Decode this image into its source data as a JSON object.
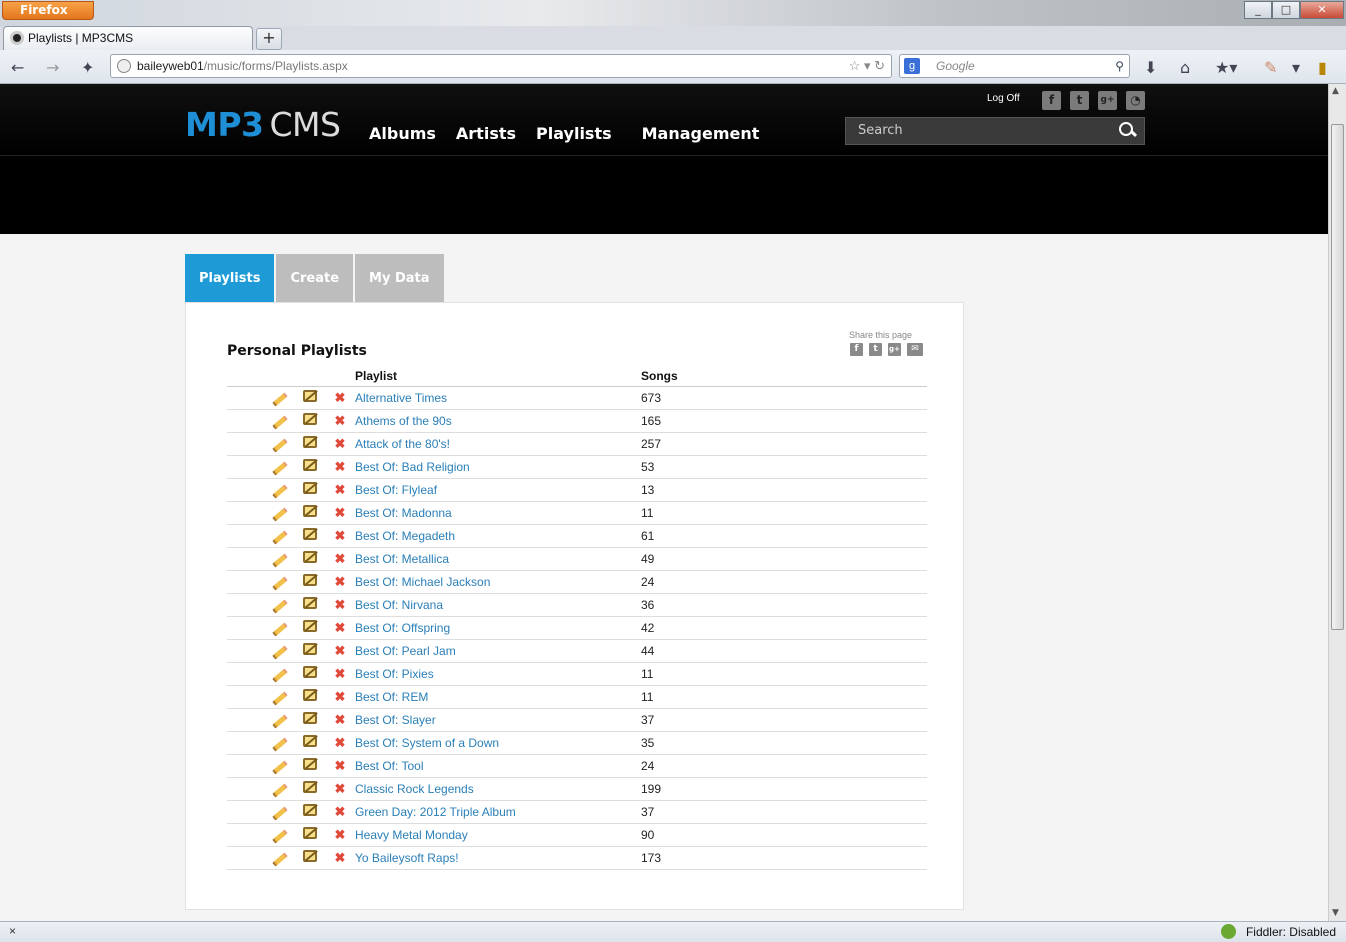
{
  "browser": {
    "app_button": "Firefox",
    "tab_title": "Playlists | MP3CMS",
    "new_tab": "+",
    "url_host": "baileyweb01",
    "url_path": "/music/forms/Playlists.aspx",
    "search_placeholder": "Google",
    "search_engine_icon": "google-g-icon",
    "status_close": "×",
    "status_fiddler": "Fiddler: Disabled"
  },
  "site": {
    "logo_mp3": "MP3",
    "logo_cms": "CMS",
    "nav": [
      "Albums",
      "Artists",
      "Playlists",
      "Management"
    ],
    "logoff": "Log Off",
    "search_placeholder": "Search",
    "social": [
      "f",
      "t",
      "g+",
      "rss"
    ],
    "accent": "#1e8fd6"
  },
  "subtabs": [
    "Playlists",
    "Create",
    "My Data"
  ],
  "panel": {
    "title": "Personal Playlists",
    "share_label": "Share this page",
    "share_icons": [
      "f",
      "t",
      "g+",
      "mail"
    ]
  },
  "table": {
    "columns": [
      "Playlist",
      "Songs"
    ],
    "rows": [
      {
        "name": "Alternative Times",
        "songs": "673"
      },
      {
        "name": "Athems of the 90s",
        "songs": "165"
      },
      {
        "name": "Attack of the 80's!",
        "songs": "257"
      },
      {
        "name": "Best Of: Bad Religion",
        "songs": "53"
      },
      {
        "name": "Best Of: Flyleaf",
        "songs": "13"
      },
      {
        "name": "Best Of: Madonna",
        "songs": "11"
      },
      {
        "name": "Best Of: Megadeth",
        "songs": "61"
      },
      {
        "name": "Best Of: Metallica",
        "songs": "49"
      },
      {
        "name": "Best Of: Michael Jackson",
        "songs": "24"
      },
      {
        "name": "Best Of: Nirvana",
        "songs": "36"
      },
      {
        "name": "Best Of: Offspring",
        "songs": "42"
      },
      {
        "name": "Best Of: Pearl Jam",
        "songs": "44"
      },
      {
        "name": "Best Of: Pixies",
        "songs": "11"
      },
      {
        "name": "Best Of: REM",
        "songs": "11"
      },
      {
        "name": "Best Of: Slayer",
        "songs": "37"
      },
      {
        "name": "Best Of: System of a Down",
        "songs": "35"
      },
      {
        "name": "Best Of: Tool",
        "songs": "24"
      },
      {
        "name": "Classic Rock Legends",
        "songs": "199"
      },
      {
        "name": "Green Day: 2012 Triple Album",
        "songs": "37"
      },
      {
        "name": "Heavy Metal Monday",
        "songs": "90"
      },
      {
        "name": "Yo Baileysoft Raps!",
        "songs": "173"
      }
    ]
  }
}
